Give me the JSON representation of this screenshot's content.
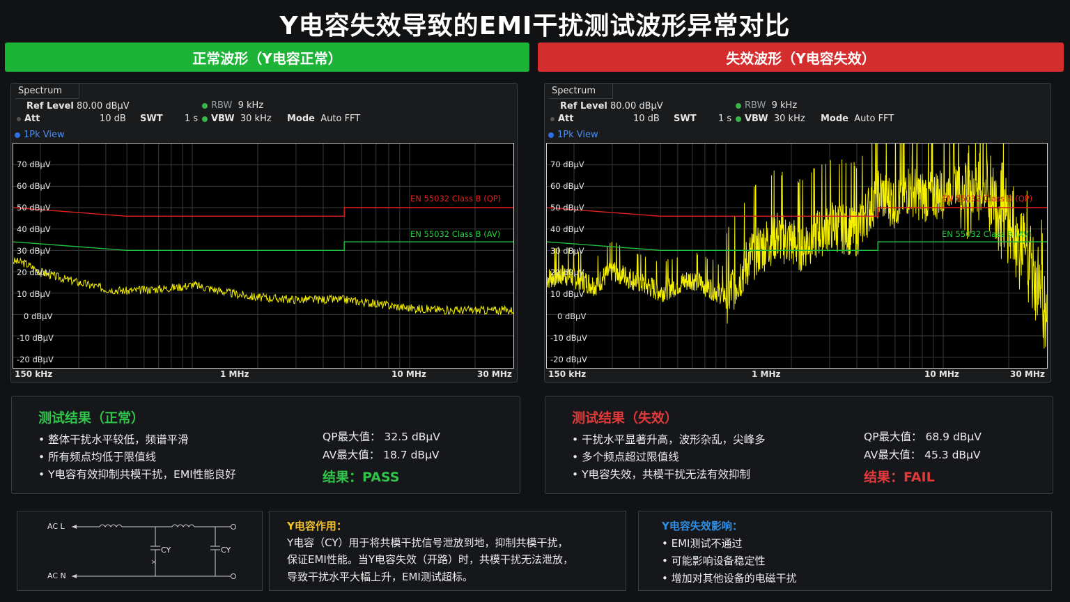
{
  "title": "Y电容失效导致的EMI干扰测试波形异常对比",
  "colors": {
    "pass_green": "#1db336",
    "fail_red": "#d42d2d",
    "trace_yellow": "#f5f000",
    "qp_limit": "#e02020",
    "av_limit": "#20c040"
  },
  "panels": [
    {
      "banner": "正常波形（Y电容正常）",
      "analyzer": {
        "tab": "Spectrum",
        "ref_level_label": "Ref Level",
        "ref_level_value": "80.00 dBμV",
        "att_label": "Att",
        "att_value": "10 dB",
        "swt_label": "SWT",
        "swt_value": "1 s",
        "rbw_label": "RBW",
        "rbw_value": "9 kHz",
        "vbw_label": "VBW",
        "vbw_value": "30 kHz",
        "mode_label": "Mode",
        "mode_value": "Auto FFT",
        "view": "1Pk View",
        "y_ticks": [
          "70 dBμV",
          "60 dBμV",
          "50 dBμV",
          "40 dBμV",
          "30 dBμV",
          "20 dBμV",
          "10 dBμV",
          "0 dBμV",
          "-10 dBμV",
          "-20 dBμV"
        ],
        "x_ticks": [
          "150 kHz",
          "1 MHz",
          "10 MHz",
          "30 MHz"
        ],
        "qp_label": "EN 55032 Class B (QP)",
        "av_label": "EN 55032 Class B (AV)"
      },
      "result": {
        "title": "测试结果（正常）",
        "bullets": [
          "• 整体干扰水平较低，频谱平滑",
          "• 所有频点均低于限值线",
          "• Y电容有效抑制共模干扰，EMI性能良好"
        ],
        "qp_label": "QP最大值：",
        "qp_value": "32.5 dBμV",
        "av_label": "AV最大值：",
        "av_value": "18.7 dBμV",
        "verdict_label": "结果：",
        "verdict_value": "PASS"
      }
    },
    {
      "banner": "失效波形（Y电容失效）",
      "analyzer": {
        "tab": "Spectrum",
        "ref_level_label": "Ref Level",
        "ref_level_value": "80.00 dBμV",
        "att_label": "Att",
        "att_value": "10 dB",
        "swt_label": "SWT",
        "swt_value": "1 s",
        "rbw_label": "RBW",
        "rbw_value": "9 kHz",
        "vbw_label": "VBW",
        "vbw_value": "30 kHz",
        "mode_label": "Mode",
        "mode_value": "Auto FFT",
        "view": "1Pk View",
        "y_ticks": [
          "70 dBμV",
          "60 dBμV",
          "50 dBμV",
          "40 dBμV",
          "30 dBμV",
          "20 dBμV",
          "10 dBμV",
          "0 dBμV",
          "-10 dBμV",
          "-20 dBμV"
        ],
        "x_ticks": [
          "150 kHz",
          "1 MHz",
          "10 MHz",
          "30 MHz"
        ],
        "qp_label": "EN 55032 Class B (QP)",
        "av_label": "EN 55032 Class B (AV)"
      },
      "result": {
        "title": "测试结果（失效）",
        "bullets": [
          "• 干扰水平显著升高，波形杂乱，尖峰多",
          "• 多个频点超过限值线",
          "• Y电容失效，共模干扰无法有效抑制"
        ],
        "qp_label": "QP最大值：",
        "qp_value": "68.9 dBμV",
        "av_label": "AV最大值：",
        "av_value": "45.3 dBμV",
        "verdict_label": "结果：",
        "verdict_value": "FAIL"
      }
    }
  ],
  "circuit": {
    "line_l": "AC L",
    "line_n": "AC N",
    "cap1": "CY",
    "cap2": "CY"
  },
  "role": {
    "title": "Y电容作用：",
    "lines": [
      "Y电容（CY）用于将共模干扰信号泄放到地，抑制共模干扰，",
      "保证EMI性能。当Y电容失效（开路）时，共模干扰无法泄放，",
      "导致干扰水平大幅上升，EMI测试超标。"
    ]
  },
  "impact": {
    "title": "Y电容失效影响：",
    "items": [
      "• EMI测试不通过",
      "• 可能影响设备稳定性",
      "• 增加对其他设备的电磁干扰"
    ]
  },
  "chart_data": [
    {
      "type": "line",
      "title": "正常波形（Y电容正常）",
      "xlabel": "",
      "ylabel": "",
      "x_scale": "log",
      "xlim_mhz": [
        0.15,
        30
      ],
      "ylim": [
        -25,
        80
      ],
      "grid": true,
      "series": [
        {
          "name": "EN 55032 Class B (QP)",
          "x_mhz": [
            0.15,
            0.5,
            5,
            5,
            30
          ],
          "y": [
            50,
            46,
            46,
            50,
            50
          ]
        },
        {
          "name": "EN 55032 Class B (AV)",
          "x_mhz": [
            0.15,
            0.5,
            5,
            5,
            30
          ],
          "y": [
            34,
            30,
            30,
            34,
            34
          ]
        },
        {
          "name": "",
          "x_mhz": [
            0.15,
            0.17,
            0.2,
            0.25,
            0.3,
            0.4,
            0.5,
            0.7,
            0.9,
            1.0,
            1.5,
            2,
            3,
            5,
            7,
            10,
            15,
            20,
            30
          ],
          "y": [
            25,
            24,
            20,
            17,
            15,
            12,
            11,
            12,
            13,
            14,
            10,
            8,
            7,
            7,
            5,
            3,
            2,
            2,
            2
          ]
        }
      ]
    },
    {
      "type": "line",
      "title": "失效波形（Y电容失效）",
      "xlabel": "",
      "ylabel": "",
      "x_scale": "log",
      "xlim_mhz": [
        0.15,
        30
      ],
      "ylim": [
        -25,
        80
      ],
      "grid": true,
      "series": [
        {
          "name": "EN 55032 Class B (QP)",
          "x_mhz": [
            0.15,
            0.5,
            5,
            5,
            30
          ],
          "y": [
            50,
            46,
            46,
            50,
            50
          ]
        },
        {
          "name": "EN 55032 Class B (AV)",
          "x_mhz": [
            0.15,
            0.5,
            5,
            5,
            30
          ],
          "y": [
            34,
            30,
            30,
            34,
            34
          ]
        },
        {
          "name": "",
          "x_mhz": [
            0.15,
            0.18,
            0.25,
            0.3,
            0.5,
            0.7,
            1.0,
            1.3,
            1.7,
            2.2,
            3,
            4,
            5,
            6,
            7,
            8,
            10,
            12,
            15,
            20,
            25,
            30
          ],
          "y": [
            18,
            20,
            15,
            22,
            12,
            18,
            10,
            30,
            40,
            35,
            45,
            42,
            60,
            55,
            62,
            58,
            60,
            65,
            69,
            50,
            30,
            10
          ]
        }
      ]
    }
  ]
}
